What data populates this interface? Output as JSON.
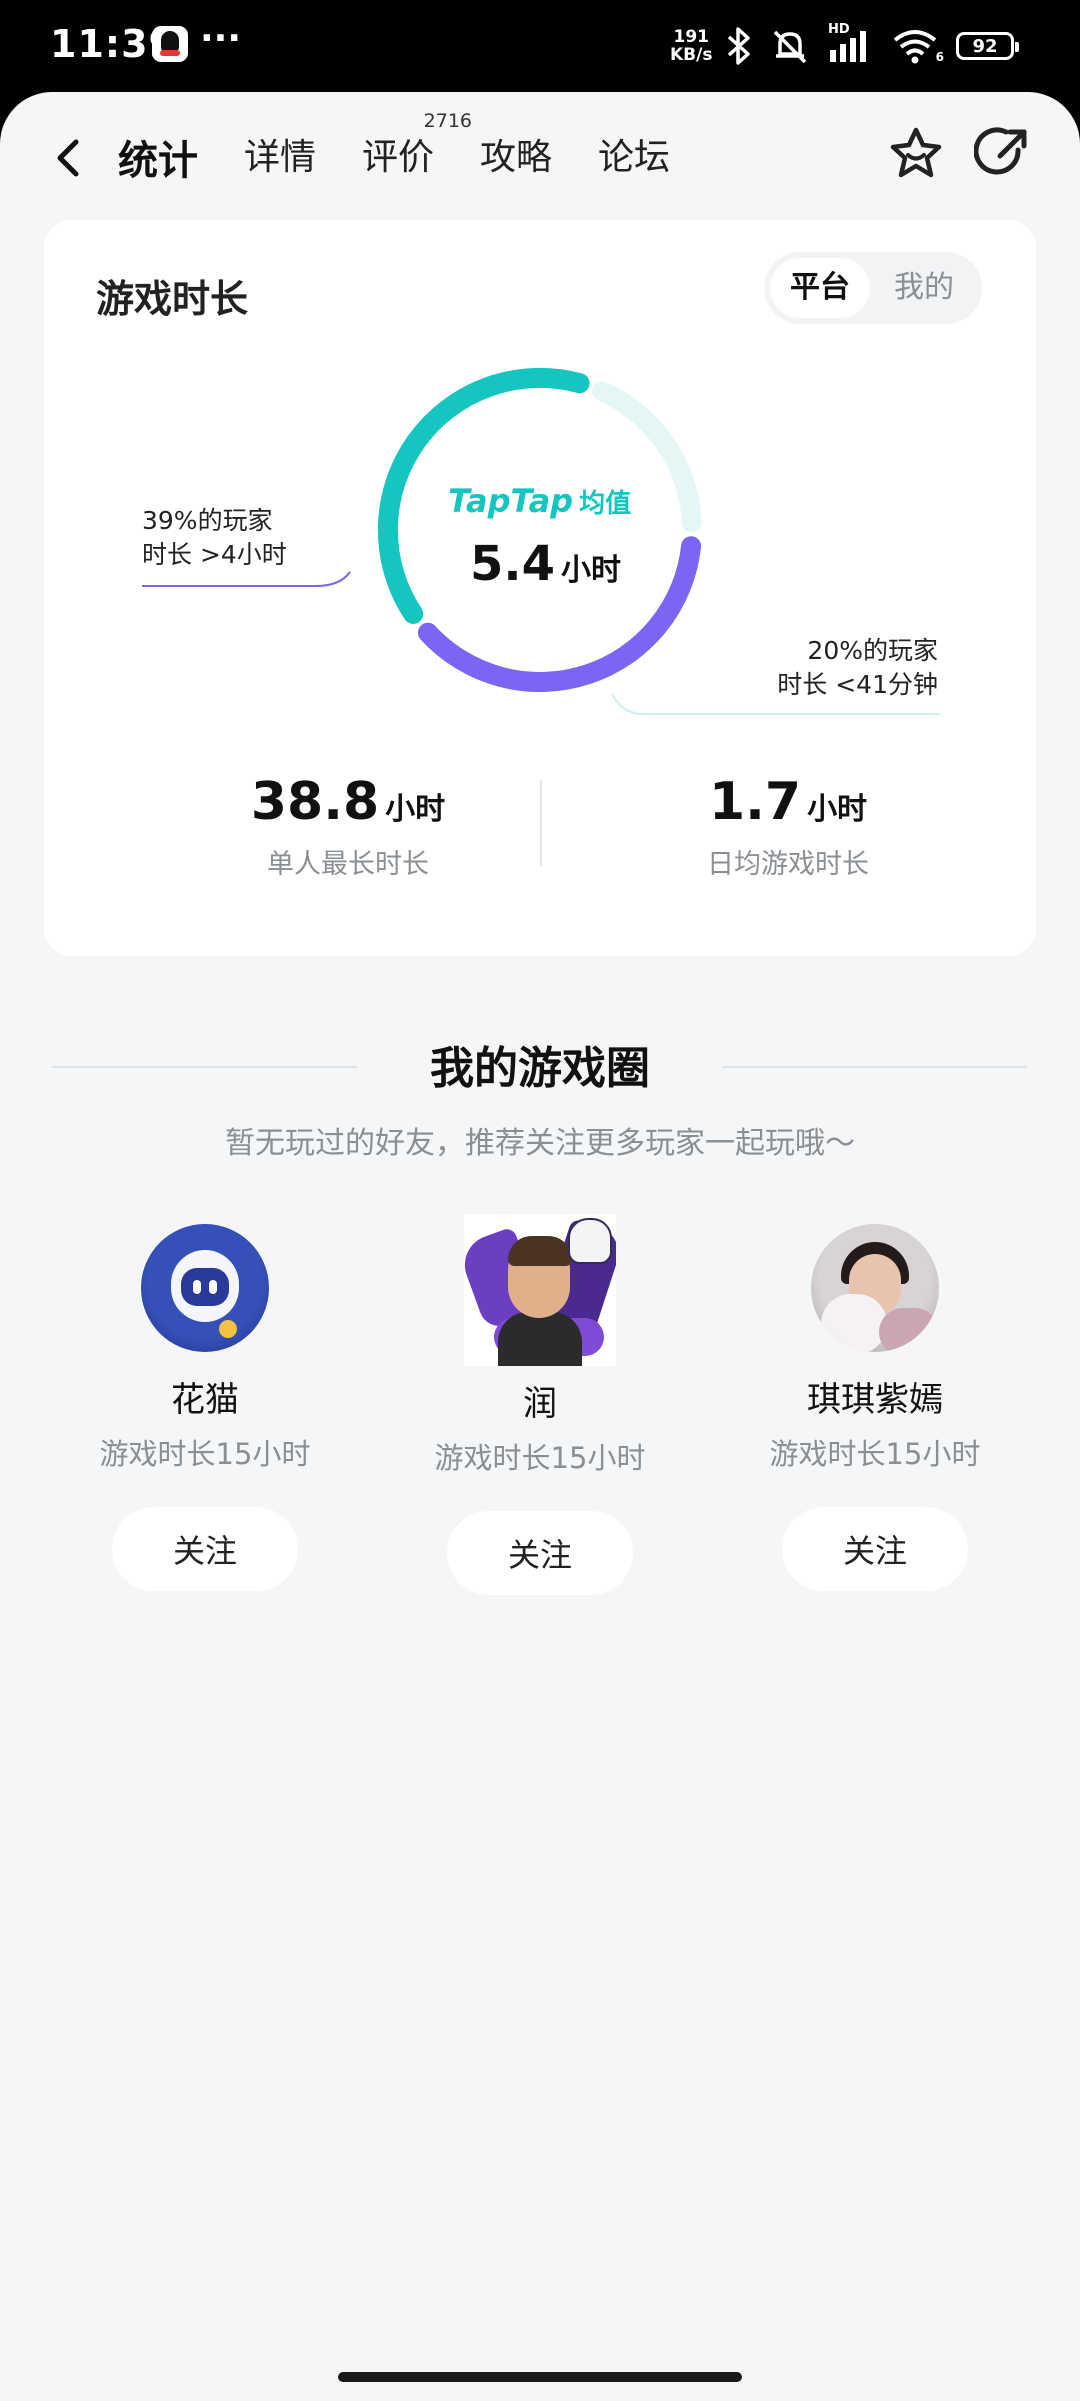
{
  "status_bar": {
    "time": "11:39",
    "more": "···",
    "net_speed_value": "191",
    "net_speed_unit": "KB/s",
    "hd": "HD",
    "wifi_sub": "6",
    "battery": "92",
    "icons": [
      "qq-icon",
      "bluetooth-icon",
      "mute-icon",
      "signal-icon",
      "wifi-icon",
      "battery-icon"
    ]
  },
  "nav": {
    "tabs": [
      {
        "label": "统计",
        "active": true
      },
      {
        "label": "详情"
      },
      {
        "label": "评价",
        "badge": "2716"
      },
      {
        "label": "攻略"
      },
      {
        "label": "论坛"
      }
    ],
    "icons": [
      "back-icon",
      "star-icon",
      "share-icon"
    ]
  },
  "stats_card": {
    "title": "游戏时长",
    "toggle": {
      "selected": "平台",
      "other": "我的"
    },
    "brand": "TapTap",
    "avg_label": "均值",
    "avg_value": "5.4",
    "avg_unit": "小时",
    "left_label_line1": "39%的玩家",
    "left_label_line2": "时长 >4小时",
    "right_label_line1": "20%的玩家",
    "right_label_line2": "时长 <41分钟",
    "metrics": [
      {
        "value": "38.8",
        "unit": "小时",
        "label": "单人最长时长"
      },
      {
        "value": "1.7",
        "unit": "小时",
        "label": "日均游戏时长"
      }
    ],
    "segments": [
      {
        "share": 0.39,
        "color": "#7a66f2"
      },
      {
        "share": 0.2,
        "color": "#e4f7f6"
      },
      {
        "share": 0.41,
        "color": "#15c5bf"
      }
    ]
  },
  "game_circle": {
    "title": "我的游戏圈",
    "subtitle": "暂无玩过的好友，推荐关注更多玩家一起玩哦～",
    "friends": [
      {
        "name": "花猫",
        "playtime": "游戏时长15小时",
        "follow": "关注"
      },
      {
        "name": "润",
        "playtime": "游戏时长15小时",
        "follow": "关注"
      },
      {
        "name": "琪琪紫嫣",
        "playtime": "游戏时长15小时",
        "follow": "关注"
      }
    ]
  }
}
